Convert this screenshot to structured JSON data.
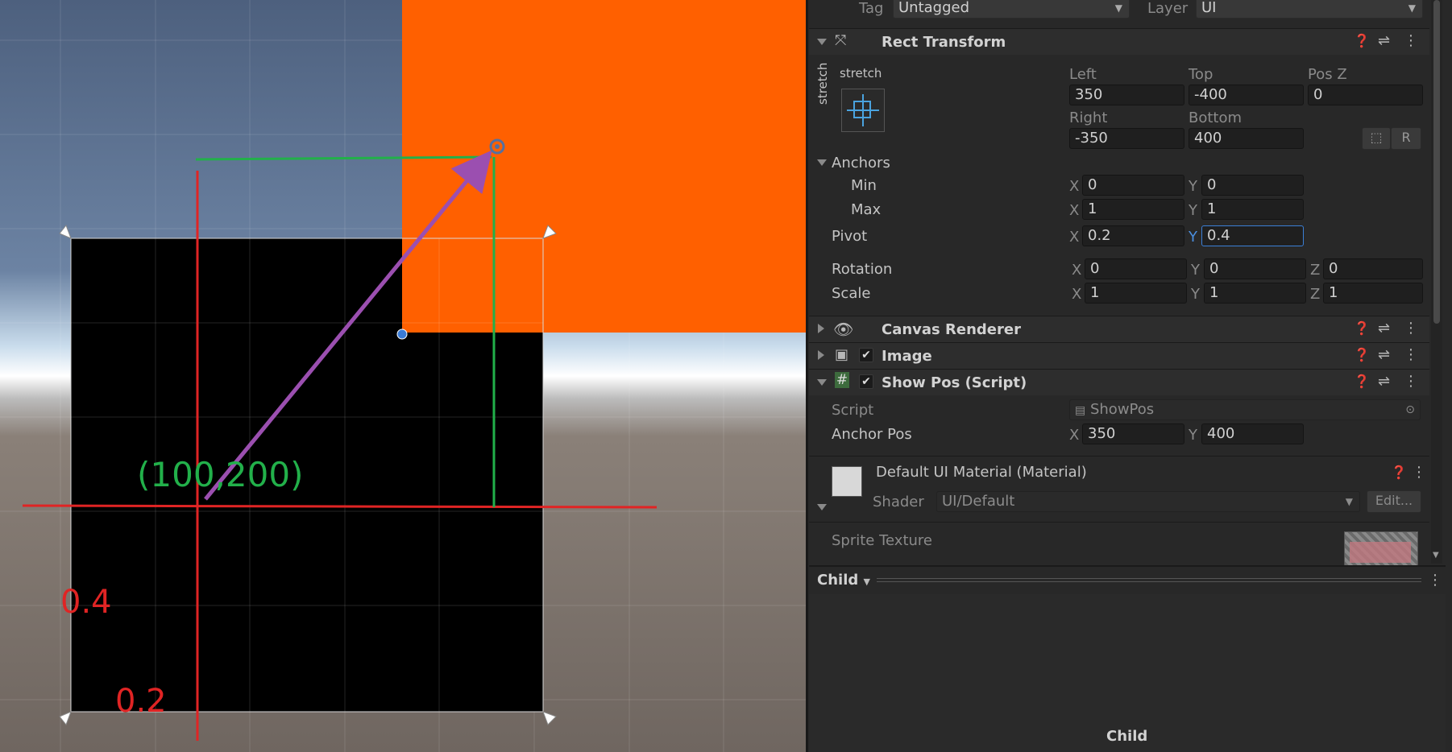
{
  "scene": {
    "annotation_coord": "(100,200)",
    "annotation_pivot_y": "0.4",
    "annotation_pivot_x": "0.2",
    "colors": {
      "orange": "#ff6000",
      "black_rect": "#000000",
      "red_line": "#e02424",
      "green_line": "#22b04a",
      "purple_arrow": "#9b4fb0",
      "anchor_blue": "#3a7bd5"
    }
  },
  "inspector": {
    "tag_label": "Tag",
    "tag_value": "Untagged",
    "layer_label": "Layer",
    "layer_value": "UI",
    "rect_transform": {
      "title": "Rect Transform",
      "stretch_top": "stretch",
      "stretch_side": "stretch",
      "left_label": "Left",
      "left_value": "350",
      "top_label": "Top",
      "top_value": "-400",
      "posz_label": "Pos Z",
      "posz_value": "0",
      "right_label": "Right",
      "right_value": "-350",
      "bottom_label": "Bottom",
      "bottom_value": "400",
      "r_button": "R",
      "anchors_label": "Anchors",
      "min_label": "Min",
      "min_x": "0",
      "min_y": "0",
      "max_label": "Max",
      "max_x": "1",
      "max_y": "1",
      "pivot_label": "Pivot",
      "pivot_x": "0.2",
      "pivot_y": "0.4",
      "rotation_label": "Rotation",
      "rot_x": "0",
      "rot_y": "0",
      "rot_z": "0",
      "scale_label": "Scale",
      "scale_x": "1",
      "scale_y": "1",
      "scale_z": "1",
      "x": "X",
      "y": "Y",
      "z": "Z"
    },
    "canvas_renderer": {
      "title": "Canvas Renderer"
    },
    "image": {
      "title": "Image"
    },
    "show_pos": {
      "title": "Show Pos (Script)",
      "script_label": "Script",
      "script_value": "ShowPos",
      "anchor_pos_label": "Anchor Pos",
      "anchor_x": "350",
      "anchor_y": "400"
    },
    "material": {
      "title": "Default UI Material (Material)",
      "shader_label": "Shader",
      "shader_value": "UI/Default",
      "edit_button": "Edit...",
      "sprite_texture_label": "Sprite Texture"
    },
    "preview": {
      "tab_label": "Child",
      "caption": "Child"
    }
  }
}
